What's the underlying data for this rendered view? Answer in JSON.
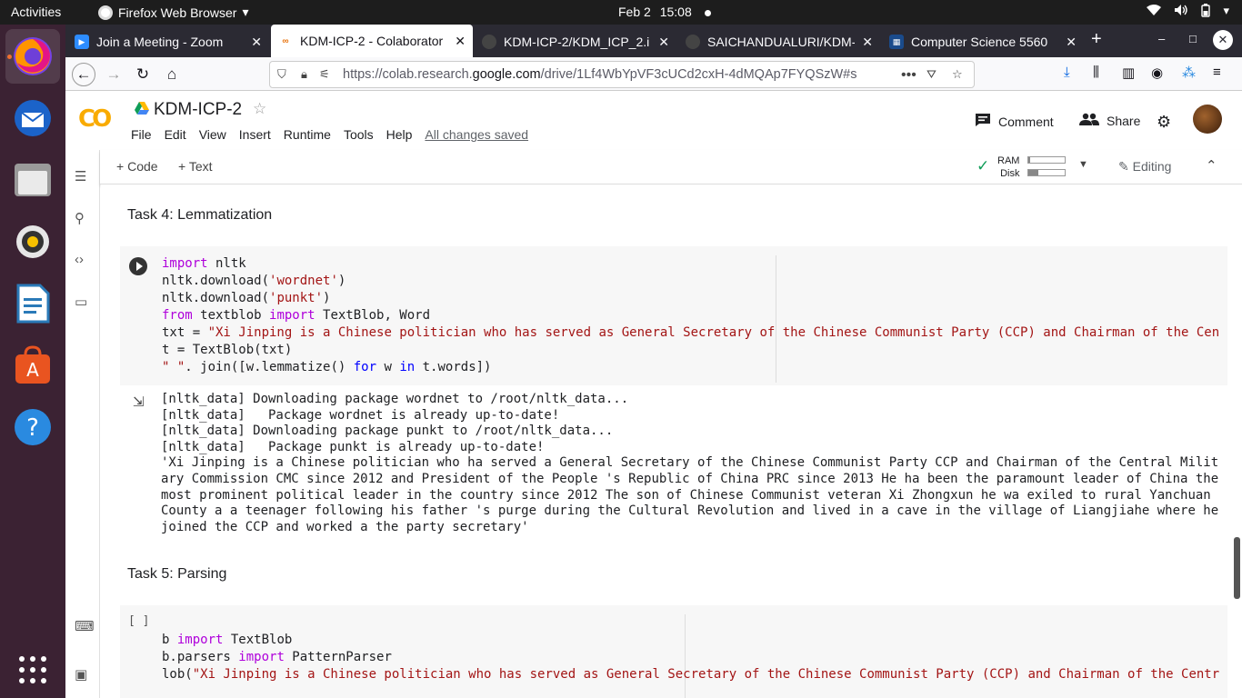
{
  "system": {
    "activities": "Activities",
    "app_name": "Firefox Web Browser",
    "date": "Feb 2",
    "time": "15:08"
  },
  "tabs": [
    {
      "title": "Join a Meeting - Zoom",
      "icon": "zoom-icon",
      "color": "#2d8cff"
    },
    {
      "title": "KDM-ICP-2 - Colaborator",
      "icon": "colab-icon",
      "color": "#e8710a"
    },
    {
      "title": "KDM-ICP-2/KDM_ICP_2.i",
      "icon": "github-icon",
      "color": "#333333"
    },
    {
      "title": "SAICHANDUALURI/KDM-",
      "icon": "github-icon",
      "color": "#333333"
    },
    {
      "title": "Computer Science 5560",
      "icon": "canvas-icon",
      "color": "#1a4b8c"
    }
  ],
  "url": {
    "prefix": "https://colab.research.",
    "domain": "google.com",
    "path": "/drive/1Lf4WbYpVF3cUCd2cxH-4dMQAp7FYQSzW#s"
  },
  "colab": {
    "logo": "CO",
    "title": "KDM-ICP-2",
    "menu": [
      "File",
      "Edit",
      "View",
      "Insert",
      "Runtime",
      "Tools",
      "Help"
    ],
    "saved_status": "All changes saved",
    "comment_label": "Comment",
    "share_label": "Share",
    "add_code": "Code",
    "add_text": "Text",
    "ram_label": "RAM",
    "disk_label": "Disk",
    "ram_level": 0.05,
    "disk_level": 0.28,
    "editing_label": "Editing"
  },
  "notebook": {
    "task4_heading": "Task 4: Lemmatization",
    "task5_heading": "Task 5: Parsing",
    "cell5_brackets": "[ ]"
  }
}
